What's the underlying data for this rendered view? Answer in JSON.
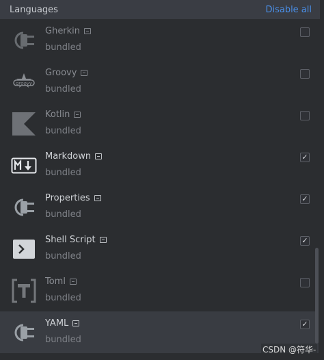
{
  "header": {
    "title": "Languages",
    "action": "Disable all"
  },
  "plugins": [
    {
      "name": "Gherkin",
      "sub": "bundled",
      "enabled": false,
      "icon": "plug-icon"
    },
    {
      "name": "Groovy",
      "sub": "bundled",
      "enabled": false,
      "icon": "groovy-logo-icon"
    },
    {
      "name": "Kotlin",
      "sub": "bundled",
      "enabled": false,
      "icon": "kotlin-icon"
    },
    {
      "name": "Markdown",
      "sub": "bundled",
      "enabled": true,
      "icon": "markdown-icon"
    },
    {
      "name": "Properties",
      "sub": "bundled",
      "enabled": true,
      "icon": "plug-icon"
    },
    {
      "name": "Shell Script",
      "sub": "bundled",
      "enabled": true,
      "icon": "terminal-icon"
    },
    {
      "name": "Toml",
      "sub": "bundled",
      "enabled": false,
      "icon": "toml-icon"
    },
    {
      "name": "YAML",
      "sub": "bundled",
      "enabled": true,
      "icon": "plug-icon"
    }
  ],
  "watermark": "CSDN @符华-",
  "colors": {
    "accent": "#4a8fe8",
    "background": "#2b2d30",
    "header": "#3a3d44",
    "selected": "#393c42"
  }
}
